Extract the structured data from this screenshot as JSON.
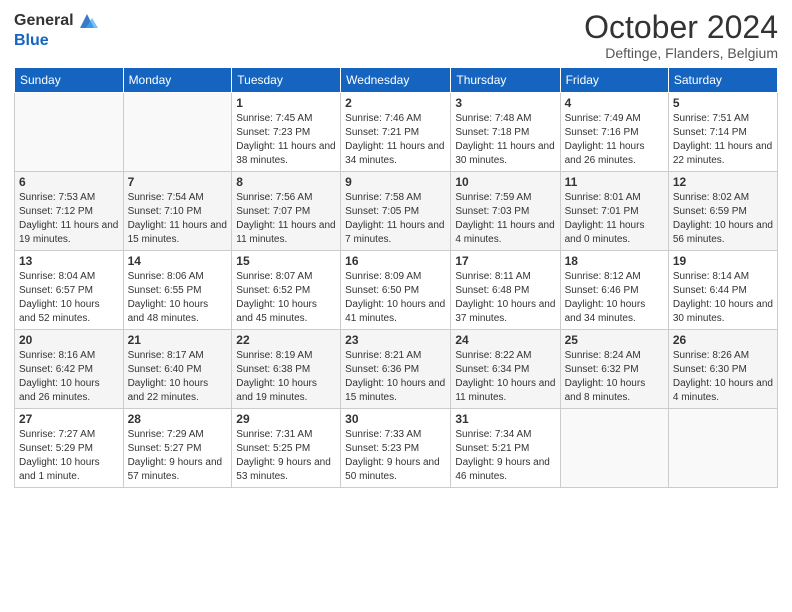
{
  "header": {
    "logo_general": "General",
    "logo_blue": "Blue",
    "title": "October 2024",
    "location": "Deftinge, Flanders, Belgium"
  },
  "weekdays": [
    "Sunday",
    "Monday",
    "Tuesday",
    "Wednesday",
    "Thursday",
    "Friday",
    "Saturday"
  ],
  "weeks": [
    [
      {
        "day": "",
        "info": ""
      },
      {
        "day": "",
        "info": ""
      },
      {
        "day": "1",
        "sunrise": "Sunrise: 7:45 AM",
        "sunset": "Sunset: 7:23 PM",
        "daylight": "Daylight: 11 hours and 38 minutes."
      },
      {
        "day": "2",
        "sunrise": "Sunrise: 7:46 AM",
        "sunset": "Sunset: 7:21 PM",
        "daylight": "Daylight: 11 hours and 34 minutes."
      },
      {
        "day": "3",
        "sunrise": "Sunrise: 7:48 AM",
        "sunset": "Sunset: 7:18 PM",
        "daylight": "Daylight: 11 hours and 30 minutes."
      },
      {
        "day": "4",
        "sunrise": "Sunrise: 7:49 AM",
        "sunset": "Sunset: 7:16 PM",
        "daylight": "Daylight: 11 hours and 26 minutes."
      },
      {
        "day": "5",
        "sunrise": "Sunrise: 7:51 AM",
        "sunset": "Sunset: 7:14 PM",
        "daylight": "Daylight: 11 hours and 22 minutes."
      }
    ],
    [
      {
        "day": "6",
        "sunrise": "Sunrise: 7:53 AM",
        "sunset": "Sunset: 7:12 PM",
        "daylight": "Daylight: 11 hours and 19 minutes."
      },
      {
        "day": "7",
        "sunrise": "Sunrise: 7:54 AM",
        "sunset": "Sunset: 7:10 PM",
        "daylight": "Daylight: 11 hours and 15 minutes."
      },
      {
        "day": "8",
        "sunrise": "Sunrise: 7:56 AM",
        "sunset": "Sunset: 7:07 PM",
        "daylight": "Daylight: 11 hours and 11 minutes."
      },
      {
        "day": "9",
        "sunrise": "Sunrise: 7:58 AM",
        "sunset": "Sunset: 7:05 PM",
        "daylight": "Daylight: 11 hours and 7 minutes."
      },
      {
        "day": "10",
        "sunrise": "Sunrise: 7:59 AM",
        "sunset": "Sunset: 7:03 PM",
        "daylight": "Daylight: 11 hours and 4 minutes."
      },
      {
        "day": "11",
        "sunrise": "Sunrise: 8:01 AM",
        "sunset": "Sunset: 7:01 PM",
        "daylight": "Daylight: 11 hours and 0 minutes."
      },
      {
        "day": "12",
        "sunrise": "Sunrise: 8:02 AM",
        "sunset": "Sunset: 6:59 PM",
        "daylight": "Daylight: 10 hours and 56 minutes."
      }
    ],
    [
      {
        "day": "13",
        "sunrise": "Sunrise: 8:04 AM",
        "sunset": "Sunset: 6:57 PM",
        "daylight": "Daylight: 10 hours and 52 minutes."
      },
      {
        "day": "14",
        "sunrise": "Sunrise: 8:06 AM",
        "sunset": "Sunset: 6:55 PM",
        "daylight": "Daylight: 10 hours and 48 minutes."
      },
      {
        "day": "15",
        "sunrise": "Sunrise: 8:07 AM",
        "sunset": "Sunset: 6:52 PM",
        "daylight": "Daylight: 10 hours and 45 minutes."
      },
      {
        "day": "16",
        "sunrise": "Sunrise: 8:09 AM",
        "sunset": "Sunset: 6:50 PM",
        "daylight": "Daylight: 10 hours and 41 minutes."
      },
      {
        "day": "17",
        "sunrise": "Sunrise: 8:11 AM",
        "sunset": "Sunset: 6:48 PM",
        "daylight": "Daylight: 10 hours and 37 minutes."
      },
      {
        "day": "18",
        "sunrise": "Sunrise: 8:12 AM",
        "sunset": "Sunset: 6:46 PM",
        "daylight": "Daylight: 10 hours and 34 minutes."
      },
      {
        "day": "19",
        "sunrise": "Sunrise: 8:14 AM",
        "sunset": "Sunset: 6:44 PM",
        "daylight": "Daylight: 10 hours and 30 minutes."
      }
    ],
    [
      {
        "day": "20",
        "sunrise": "Sunrise: 8:16 AM",
        "sunset": "Sunset: 6:42 PM",
        "daylight": "Daylight: 10 hours and 26 minutes."
      },
      {
        "day": "21",
        "sunrise": "Sunrise: 8:17 AM",
        "sunset": "Sunset: 6:40 PM",
        "daylight": "Daylight: 10 hours and 22 minutes."
      },
      {
        "day": "22",
        "sunrise": "Sunrise: 8:19 AM",
        "sunset": "Sunset: 6:38 PM",
        "daylight": "Daylight: 10 hours and 19 minutes."
      },
      {
        "day": "23",
        "sunrise": "Sunrise: 8:21 AM",
        "sunset": "Sunset: 6:36 PM",
        "daylight": "Daylight: 10 hours and 15 minutes."
      },
      {
        "day": "24",
        "sunrise": "Sunrise: 8:22 AM",
        "sunset": "Sunset: 6:34 PM",
        "daylight": "Daylight: 10 hours and 11 minutes."
      },
      {
        "day": "25",
        "sunrise": "Sunrise: 8:24 AM",
        "sunset": "Sunset: 6:32 PM",
        "daylight": "Daylight: 10 hours and 8 minutes."
      },
      {
        "day": "26",
        "sunrise": "Sunrise: 8:26 AM",
        "sunset": "Sunset: 6:30 PM",
        "daylight": "Daylight: 10 hours and 4 minutes."
      }
    ],
    [
      {
        "day": "27",
        "sunrise": "Sunrise: 7:27 AM",
        "sunset": "Sunset: 5:29 PM",
        "daylight": "Daylight: 10 hours and 1 minute."
      },
      {
        "day": "28",
        "sunrise": "Sunrise: 7:29 AM",
        "sunset": "Sunset: 5:27 PM",
        "daylight": "Daylight: 9 hours and 57 minutes."
      },
      {
        "day": "29",
        "sunrise": "Sunrise: 7:31 AM",
        "sunset": "Sunset: 5:25 PM",
        "daylight": "Daylight: 9 hours and 53 minutes."
      },
      {
        "day": "30",
        "sunrise": "Sunrise: 7:33 AM",
        "sunset": "Sunset: 5:23 PM",
        "daylight": "Daylight: 9 hours and 50 minutes."
      },
      {
        "day": "31",
        "sunrise": "Sunrise: 7:34 AM",
        "sunset": "Sunset: 5:21 PM",
        "daylight": "Daylight: 9 hours and 46 minutes."
      },
      {
        "day": "",
        "info": ""
      },
      {
        "day": "",
        "info": ""
      }
    ]
  ]
}
